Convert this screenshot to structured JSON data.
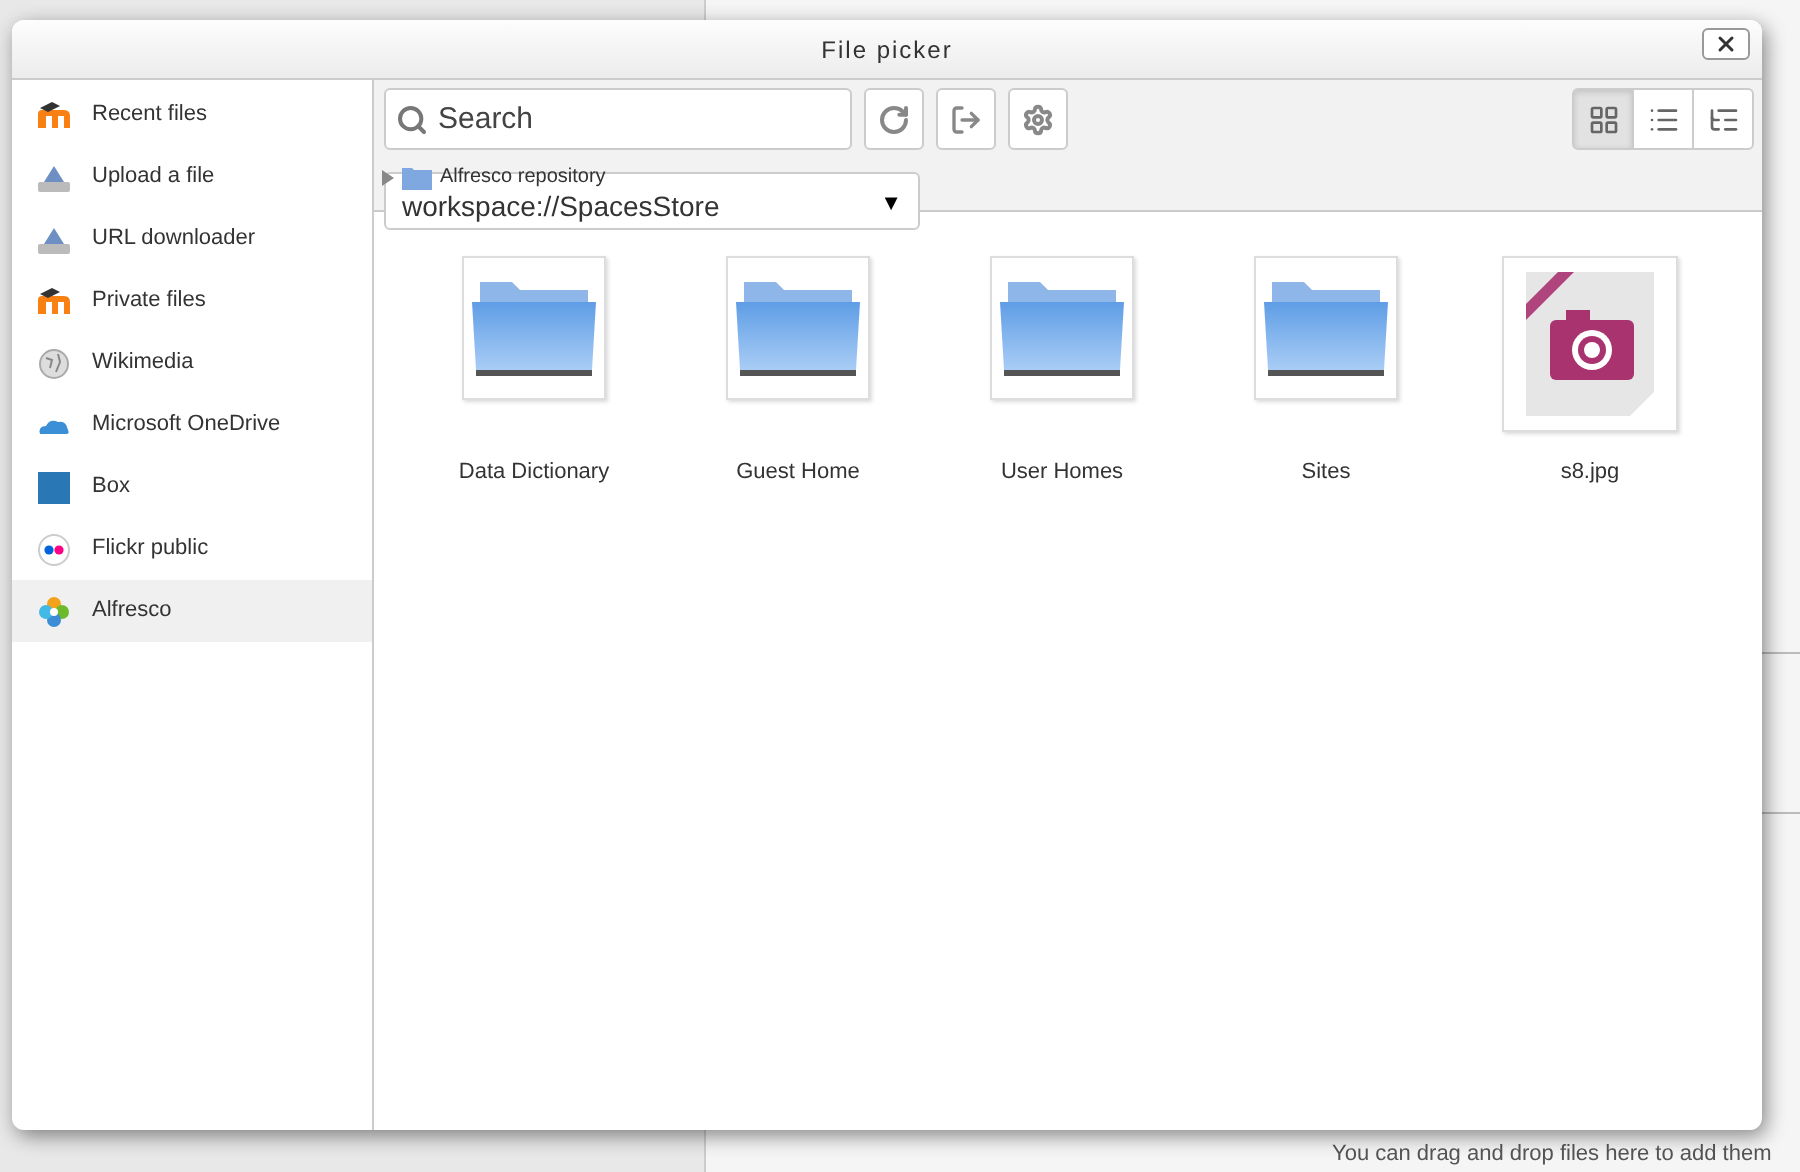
{
  "window": {
    "title": "File picker"
  },
  "sidebar": {
    "items": [
      {
        "label": "Recent files",
        "selected": false
      },
      {
        "label": "Upload a file",
        "selected": false
      },
      {
        "label": "URL downloader",
        "selected": false
      },
      {
        "label": "Private files",
        "selected": false
      },
      {
        "label": "Wikimedia",
        "selected": false
      },
      {
        "label": "Microsoft OneDrive",
        "selected": false
      },
      {
        "label": "Box",
        "selected": false
      },
      {
        "label": "Flickr public",
        "selected": false
      },
      {
        "label": "Alfresco",
        "selected": true
      }
    ]
  },
  "toolbar": {
    "search": {
      "placeholder": "Search"
    },
    "view_modes": [
      {
        "selected": true
      },
      {
        "selected": false
      },
      {
        "selected": false
      }
    ]
  },
  "breadcrumb": {
    "label": "Alfresco repository"
  },
  "repository_select": {
    "value": "workspace://SpacesStore",
    "arrow": "▼"
  },
  "files": [
    {
      "name": "Data Dictionary",
      "kind": "folder"
    },
    {
      "name": "Guest Home",
      "kind": "folder"
    },
    {
      "name": "User Homes",
      "kind": "folder"
    },
    {
      "name": "Sites",
      "kind": "folder"
    },
    {
      "name": "s8.jpg",
      "kind": "image"
    }
  ],
  "footer_hint": "You can drag and drop files here to add them"
}
